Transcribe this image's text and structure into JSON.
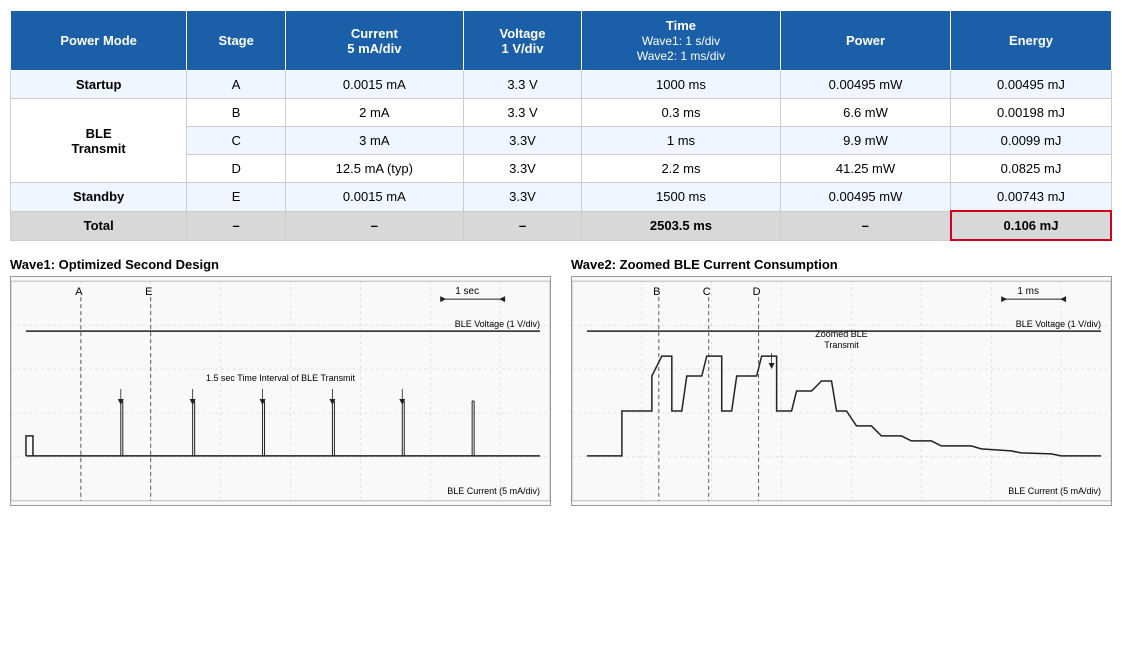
{
  "table": {
    "headers": [
      "Power Mode",
      "Stage",
      "Current\n5 mA/div",
      "Voltage\n1 V/div",
      "Time\nWave1: 1 s/div\nWave2: 1 ms/div",
      "Power",
      "Energy"
    ],
    "rows": [
      {
        "mode": "Startup",
        "stage": "A",
        "current": "0.0015 mA",
        "voltage": "3.3 V",
        "time": "1000 ms",
        "power": "0.00495 mW",
        "energy": "0.00495 mJ",
        "rowClass": "row-light",
        "modeSpan": 1,
        "highlighted": false
      },
      {
        "mode": "BLE\nTransmit",
        "stage": "B",
        "current": "2 mA",
        "voltage": "3.3 V",
        "time": "0.3 ms",
        "power": "6.6 mW",
        "energy": "0.00198 mJ",
        "rowClass": "row-white",
        "modeSpan": 3,
        "highlighted": false
      },
      {
        "mode": null,
        "stage": "C",
        "current": "3 mA",
        "voltage": "3.3V",
        "time": "1 ms",
        "power": "9.9 mW",
        "energy": "0.0099 mJ",
        "rowClass": "row-light",
        "modeSpan": 0,
        "highlighted": false
      },
      {
        "mode": null,
        "stage": "D",
        "current": "12.5 mA (typ)",
        "voltage": "3.3V",
        "time": "2.2 ms",
        "power": "41.25 mW",
        "energy": "0.0825 mJ",
        "rowClass": "row-white",
        "modeSpan": 0,
        "highlighted": false
      },
      {
        "mode": "Standby",
        "stage": "E",
        "current": "0.0015 mA",
        "voltage": "3.3V",
        "time": "1500 ms",
        "power": "0.00495 mW",
        "energy": "0.00743 mJ",
        "rowClass": "row-light",
        "modeSpan": 1,
        "highlighted": false
      },
      {
        "mode": "Total",
        "stage": "–",
        "current": "–",
        "voltage": "–",
        "time": "2503.5 ms",
        "power": "–",
        "energy": "0.106 mJ",
        "rowClass": "row-total",
        "modeSpan": 1,
        "highlighted": true
      }
    ]
  },
  "wave1": {
    "title": "Wave1: Optimized Second Design",
    "label_voltage": "BLE Voltage (1 V/div)",
    "label_current": "BLE Current (5 mA/div)",
    "label_time": "1 sec",
    "annotation": "1.5 sec Time Interval of BLE Transmit",
    "markers": [
      "A",
      "E"
    ]
  },
  "wave2": {
    "title": "Wave2: Zoomed BLE Current Consumption",
    "label_voltage": "BLE Voltage (1 V/div)",
    "label_current": "BLE Current (5 mA/div)",
    "label_time": "1 ms",
    "annotation": "Zoomed BLE\nTransmit",
    "markers": [
      "B",
      "C",
      "D"
    ]
  }
}
